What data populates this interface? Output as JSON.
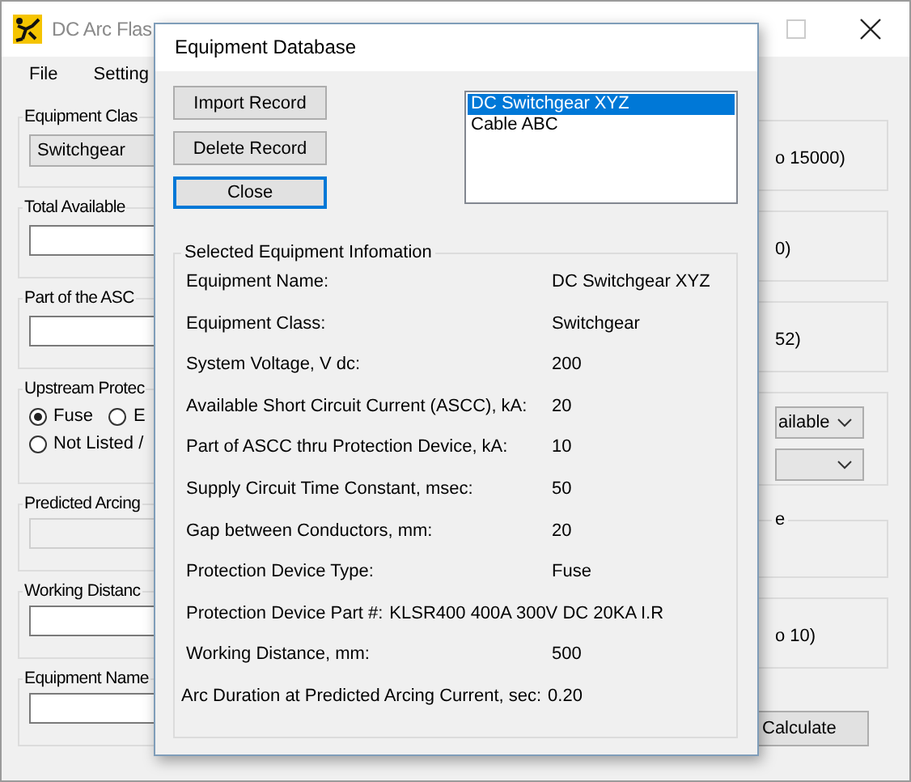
{
  "main_window": {
    "title": "DC Arc Flas",
    "menu": [
      "File",
      "Setting"
    ],
    "left_groups": [
      {
        "label": "Equipment Clas",
        "kind": "combo",
        "value": "Switchgear"
      },
      {
        "label": "Total Available",
        "kind": "field",
        "disabled": false
      },
      {
        "label": "Part of the ASC",
        "kind": "field",
        "disabled": false
      },
      {
        "label": "Upstream Protec",
        "kind": "radios",
        "options": [
          {
            "label": "Fuse",
            "selected": true
          },
          {
            "label": "E",
            "selected": false
          },
          {
            "label": "Not Listed /",
            "selected": false
          }
        ]
      },
      {
        "label": "Predicted Arcing",
        "kind": "field",
        "disabled": true
      },
      {
        "label": "Working Distanc",
        "kind": "field",
        "disabled": false
      },
      {
        "label": "Equipment Name",
        "kind": "field",
        "disabled": false
      }
    ],
    "right_groups": [
      {
        "kind": "text",
        "text": "o 15000)"
      },
      {
        "kind": "text",
        "text": "0)"
      },
      {
        "kind": "text",
        "text": "52)"
      },
      {
        "kind": "dropdowns",
        "items": [
          {
            "kind": "dropdown",
            "value": "ailable"
          },
          {
            "kind": "dropdown"
          }
        ]
      },
      {
        "kind": "label",
        "label": "e"
      },
      {
        "kind": "text",
        "text": "o 10)"
      }
    ],
    "calculate_button": "Calculate"
  },
  "dialog": {
    "title": "Equipment Database",
    "buttons": [
      {
        "label": "Import Record",
        "default": false
      },
      {
        "label": "Delete Record",
        "default": false
      },
      {
        "label": "Close",
        "default": true
      }
    ],
    "records": [
      {
        "label": "DC Switchgear XYZ",
        "selected": true
      },
      {
        "label": "Cable ABC",
        "selected": false
      }
    ],
    "info": {
      "title": "Selected Equipment Infomation",
      "rows": [
        {
          "kind": "column",
          "label": "Equipment Name:",
          "value": "DC Switchgear XYZ"
        },
        {
          "kind": "column",
          "label": "Equipment Class:",
          "value": "Switchgear"
        },
        {
          "kind": "column",
          "label": "System Voltage, V dc:",
          "value": "200"
        },
        {
          "kind": "column",
          "label": "Available Short Circuit Current (ASCC), kA:",
          "value": "20"
        },
        {
          "kind": "column",
          "label": "Part of ASCC thru Protection Device, kA:",
          "value": "10"
        },
        {
          "kind": "column",
          "label": "Supply Circuit Time Constant, msec:",
          "value": "50"
        },
        {
          "kind": "column",
          "label": "Gap between Conductors, mm:",
          "value": "20"
        },
        {
          "kind": "column",
          "label": "Protection Device Type:",
          "value": "Fuse"
        },
        {
          "kind": "inline",
          "label": "Protection Device Part #:",
          "value": "KLSR400 400A 300V DC 20KA I.R"
        },
        {
          "kind": "column",
          "label": "Working Distance, mm:",
          "value": "500"
        },
        {
          "kind": "inline",
          "label": "Arc Duration at Predicted Arcing Current, sec:",
          "value": "0.20"
        }
      ]
    }
  }
}
